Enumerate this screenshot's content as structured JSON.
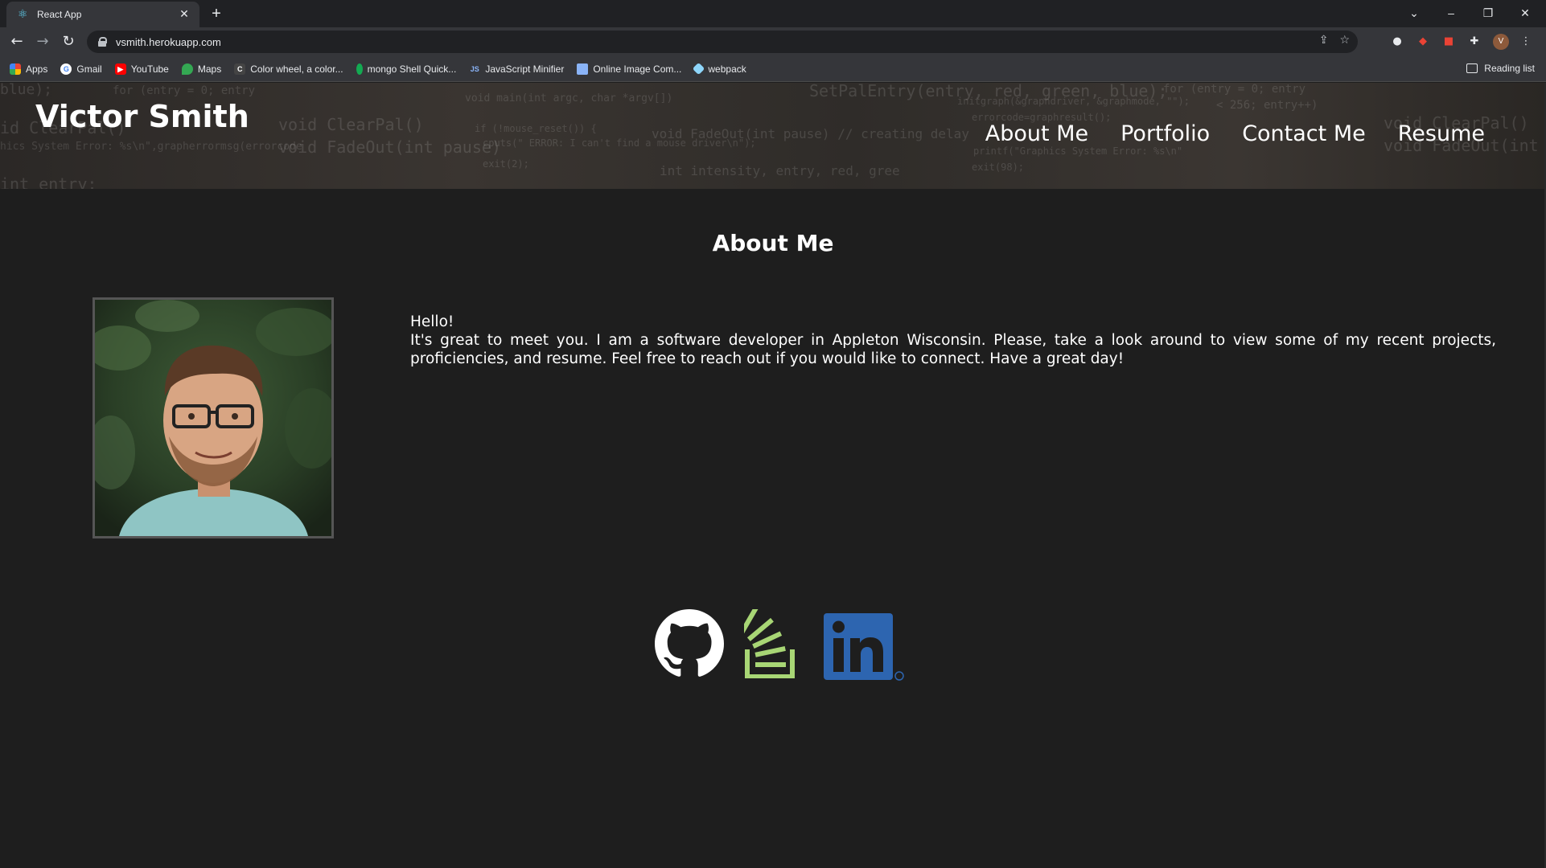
{
  "browser": {
    "tab_title": "React App",
    "url": "vsmith.herokuapp.com",
    "bookmarks": [
      {
        "label": "Apps",
        "icon": "apps-grid-icon",
        "color": "#4285f4"
      },
      {
        "label": "Gmail",
        "icon": "google-icon",
        "color": "#ffffff"
      },
      {
        "label": "YouTube",
        "icon": "youtube-icon",
        "color": "#ff0000"
      },
      {
        "label": "Maps",
        "icon": "maps-pin-icon",
        "color": "#34a853"
      },
      {
        "label": "Color wheel, a color...",
        "icon": "canva-icon",
        "color": "#2b2b2b"
      },
      {
        "label": "mongo Shell Quick...",
        "icon": "mongodb-leaf-icon",
        "color": "#13aa52"
      },
      {
        "label": "JavaScript Minifier",
        "icon": "js-icon",
        "color": "#3b6fb6"
      },
      {
        "label": "Online Image Com...",
        "icon": "folder-icon",
        "color": "#8ab4f8"
      },
      {
        "label": "webpack",
        "icon": "webpack-icon",
        "color": "#8ed6fb"
      }
    ],
    "reading_list": "Reading list",
    "avatar_letter": "V"
  },
  "site": {
    "title": "Victor Smith",
    "nav": [
      "About Me",
      "Portfolio",
      "Contact Me",
      "Resume"
    ],
    "section_title": "About Me",
    "greeting": "Hello!",
    "bio": "It's great to meet you. I am a software developer in Appleton Wisconsin. Please, take a look around to view some of my recent projects, proficiencies, and resume. Feel free to reach out if you would like to connect. Have a great day!",
    "header_code_lines": [
      "blue);",
      "for (entry = 0; entry",
      "void main(int argc, char *argv[])",
      "SetPalEntry(entry, red, green, blue);",
      "void ClearPal()",
      "void FadeOut(int pause)",
      "cputs(\" ERROR: I can't find a mouse driver\\n\");",
      "exit(2);",
      "void FadeOut(int pause) // creating delay",
      "int intensity, entry, red, gree",
      "if (!mouse_reset()) {",
      "initgraph(&graphdriver, &graphmode, \"\");",
      "errorcode=graphresult();",
      "for (entry = 0; entry",
      "< 256; entry++)",
      "id ClearPal()",
      "hics System Error: %s\\n\",grapherrormsg(errorcode",
      "printf(\"Graphics System Error: %s\\n\"",
      "exit(98);",
      "int entry;",
      "void ClearPal()",
      "void FadeOut(int pause)"
    ],
    "social": [
      {
        "name": "GitHub",
        "icon": "github-icon",
        "color": "#ffffff"
      },
      {
        "name": "Stack Overflow",
        "icon": "stackoverflow-icon",
        "color": "#a8d675"
      },
      {
        "name": "LinkedIn",
        "icon": "linkedin-icon",
        "color": "#2d65b0"
      }
    ]
  }
}
